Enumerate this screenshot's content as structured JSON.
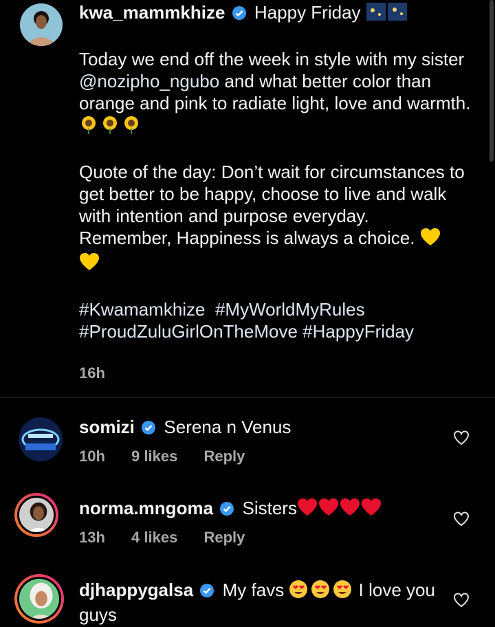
{
  "post": {
    "username": "kwa_mammkhize",
    "greeting": "Happy Friday",
    "line1": "Today we end off the week in style with my sister",
    "mention": "@nozipho_ngubo",
    "line2": "and what better color than orange and pink to radiate light, love and warmth.",
    "quote": "Quote of the day: Don’t wait for circumstances to get better to be happy, choose to live and walk with intention and purpose everyday.",
    "remember": "Remember, Happiness is always a choice.",
    "hashtags_line1": "#Kwamamkhize  #MyWorldMyRules",
    "hashtags_line2": "#ProudZuluGirlOnTheMove #HappyFriday",
    "time": "16h"
  },
  "comments": [
    {
      "username": "somizi",
      "text": "Serena n Venus",
      "time": "10h",
      "likes": "9 likes",
      "reply": "Reply"
    },
    {
      "username": "norma.mngoma",
      "text": "Sisters",
      "time": "13h",
      "likes": "4 likes",
      "reply": "Reply"
    },
    {
      "username": "djhappygalsa",
      "text": "My favs",
      "text2": "I love you guys"
    }
  ],
  "colors": {
    "background": "#000000",
    "verified": "#3897f0",
    "ring_start": "#f58529",
    "ring_end": "#dd2a7b"
  },
  "icons": [
    "verified-badge-icon",
    "sparkles-icon",
    "sunflower-icon",
    "yellow-heart-icon",
    "red-heart-icon",
    "heart-eyes-icon",
    "like-heart-icon"
  ]
}
